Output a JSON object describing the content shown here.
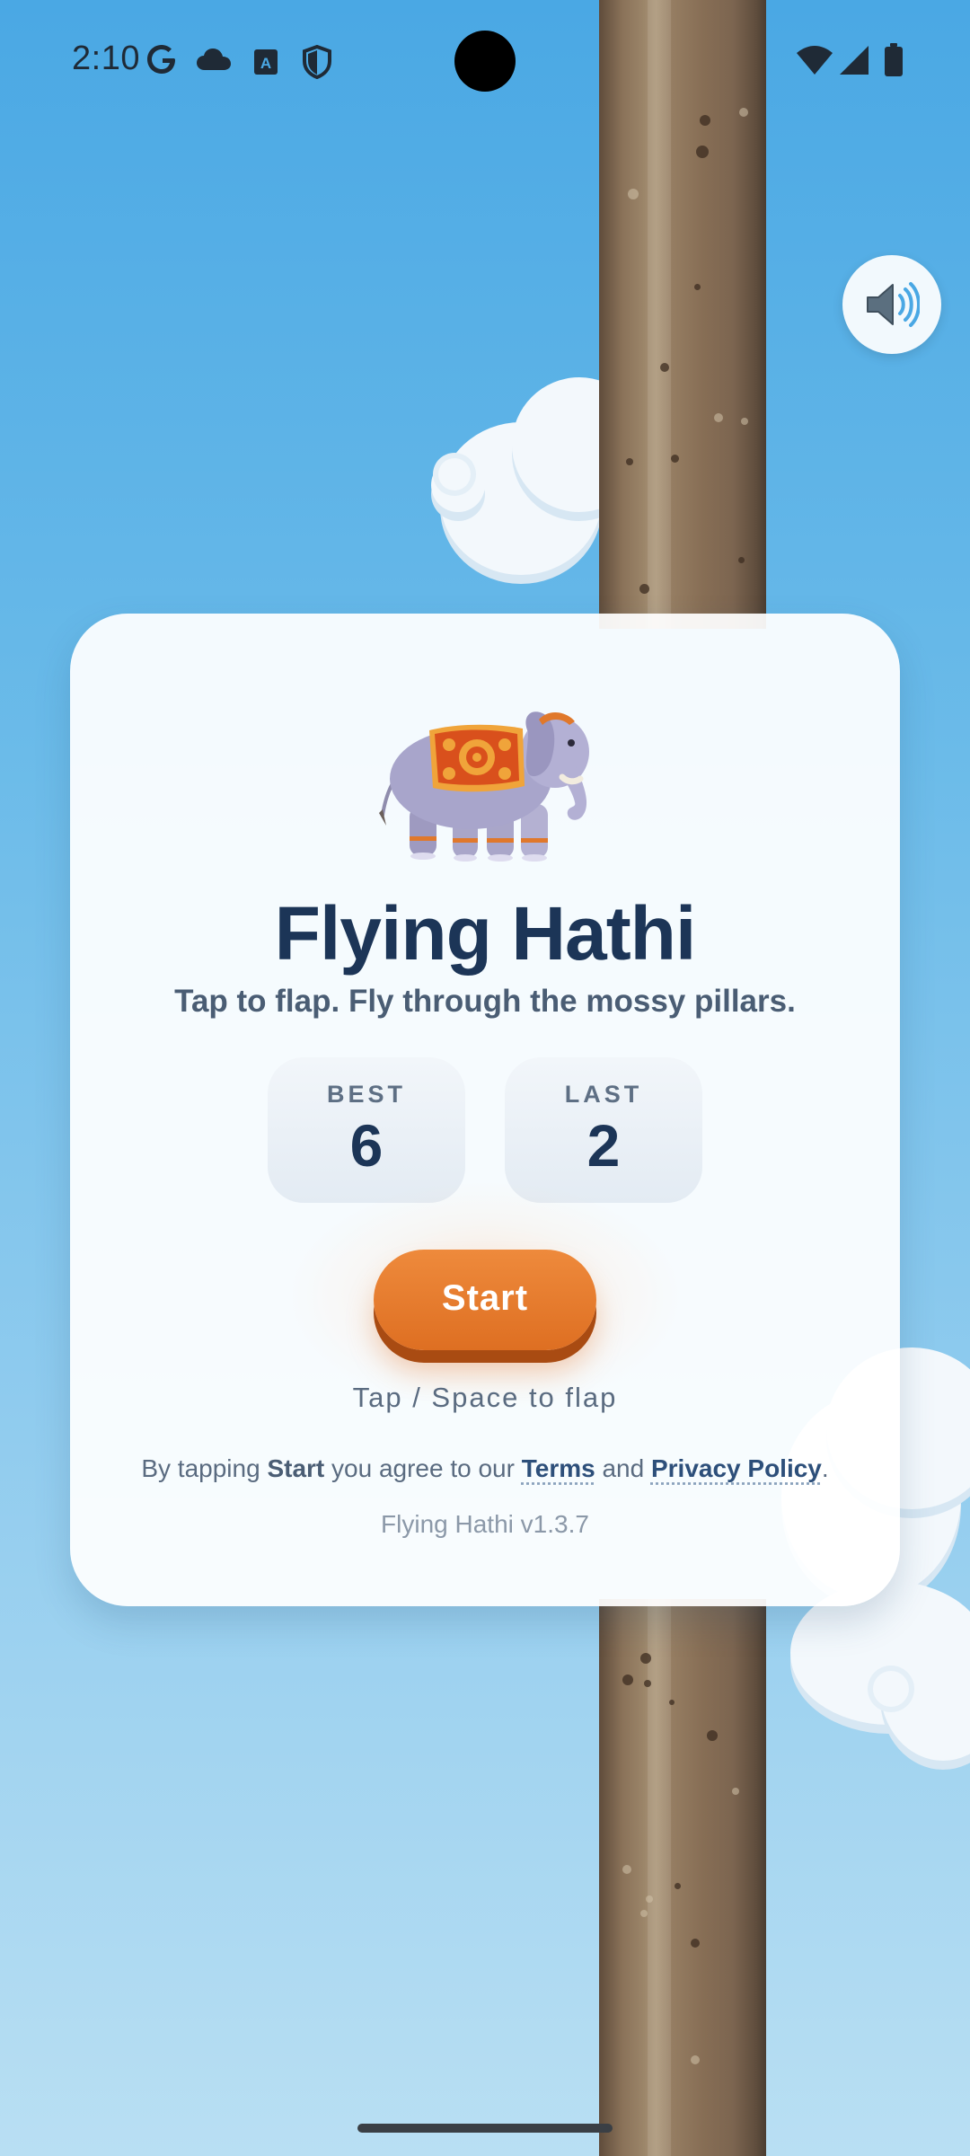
{
  "status_bar": {
    "time": "2:10",
    "left_icons": [
      "google-icon",
      "cloud-icon",
      "text-a-icon",
      "shield-icon"
    ],
    "right_icons": [
      "wifi-icon",
      "cellular-icon",
      "battery-icon"
    ]
  },
  "sound": {
    "icon": "speaker-icon"
  },
  "card": {
    "mascot_icon": "elephant-icon",
    "title": "Flying Hathi",
    "subtitle": "Tap to flap. Fly through the mossy pillars.",
    "stats": {
      "best_label": "BEST",
      "best_value": "6",
      "last_label": "LAST",
      "last_value": "2"
    },
    "start_label": "Start",
    "hint": "Tap / Space to flap",
    "legal": {
      "prefix": "By tapping ",
      "start_word": "Start",
      "middle": " you agree to our ",
      "terms_link": "Terms",
      "and": " and ",
      "privacy_link": "Privacy Policy",
      "suffix": "."
    },
    "version": "Flying Hathi v1.3.7"
  },
  "colors": {
    "sky_top": "#4aa8e4",
    "sky_bottom": "#b9dff3",
    "title": "#1c3557",
    "start_button": "#e57a2c",
    "pillar": "#8a7259"
  }
}
